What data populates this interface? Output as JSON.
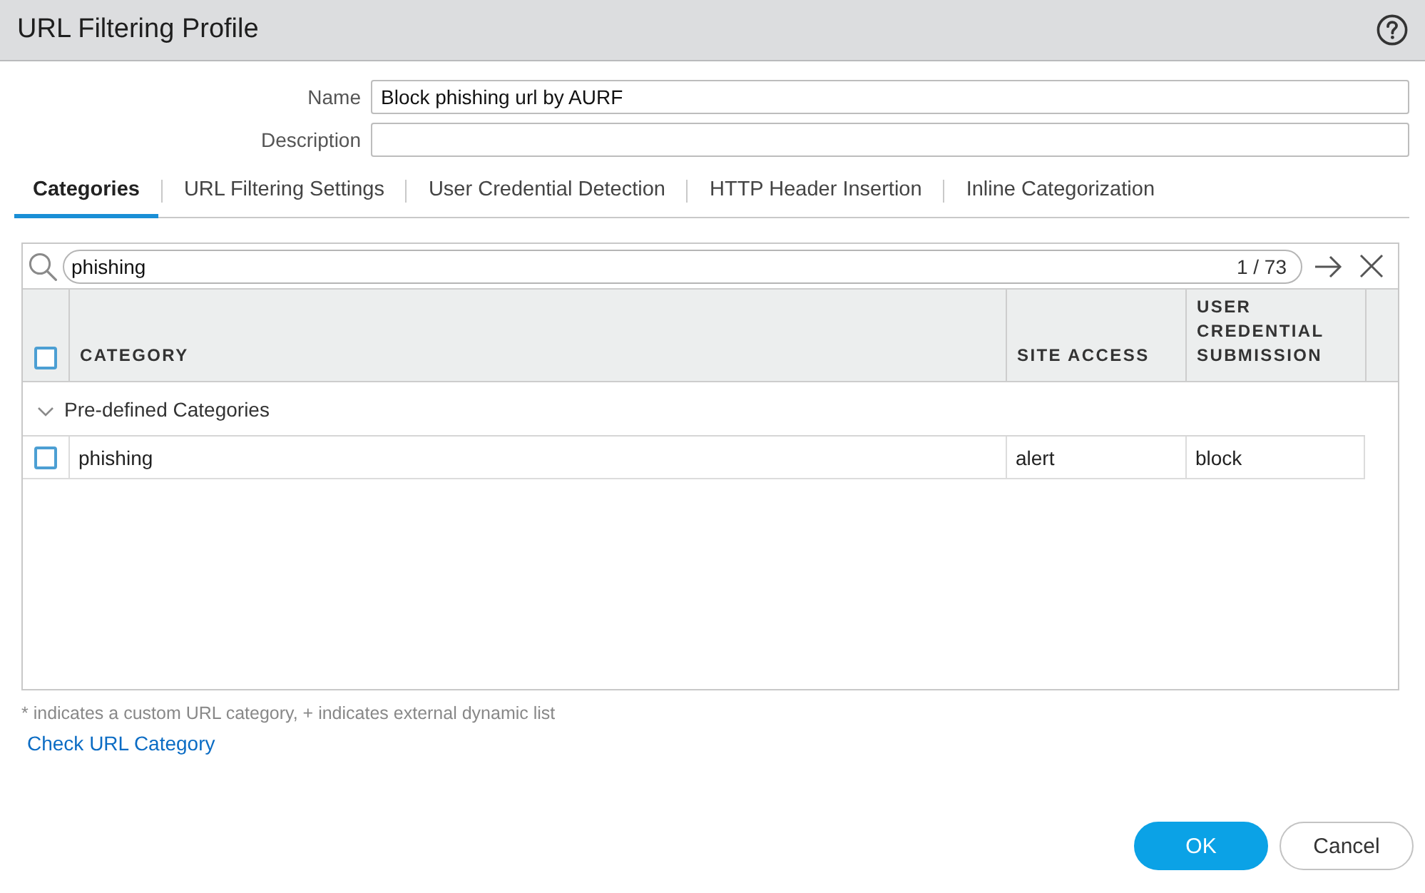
{
  "window": {
    "title": "URL Filtering Profile"
  },
  "form": {
    "fields": [
      {
        "label": "Name",
        "value": "Block phishing url by AURF"
      },
      {
        "label": "Description"
      }
    ]
  },
  "tabs": [
    {
      "label": "Categories",
      "selected": true
    },
    {
      "label": "URL Filtering Settings",
      "selected": false
    },
    {
      "label": "User Credential Detection",
      "selected": false
    },
    {
      "label": "HTTP Header Insertion",
      "selected": false
    },
    {
      "label": "Inline Categorization",
      "selected": false
    }
  ],
  "search": {
    "value": "phishing",
    "match_count": "1 / 73"
  },
  "table": {
    "header_checked": false,
    "columns": [
      "CATEGORY",
      "SITE ACCESS",
      "USER CREDENTIAL SUBMISSION"
    ],
    "groups": [
      {
        "label": "Pre-defined Categories",
        "expanded": true,
        "rows": [
          {
            "checked": false,
            "cells": [
              "phishing",
              "alert",
              "block"
            ]
          }
        ]
      }
    ]
  },
  "footnote": "* indicates a custom URL category, + indicates external dynamic list",
  "link": "Check URL Category",
  "buttons": [
    {
      "label": "OK",
      "kind": "primary"
    },
    {
      "label": "Cancel",
      "kind": "secondary"
    }
  ]
}
